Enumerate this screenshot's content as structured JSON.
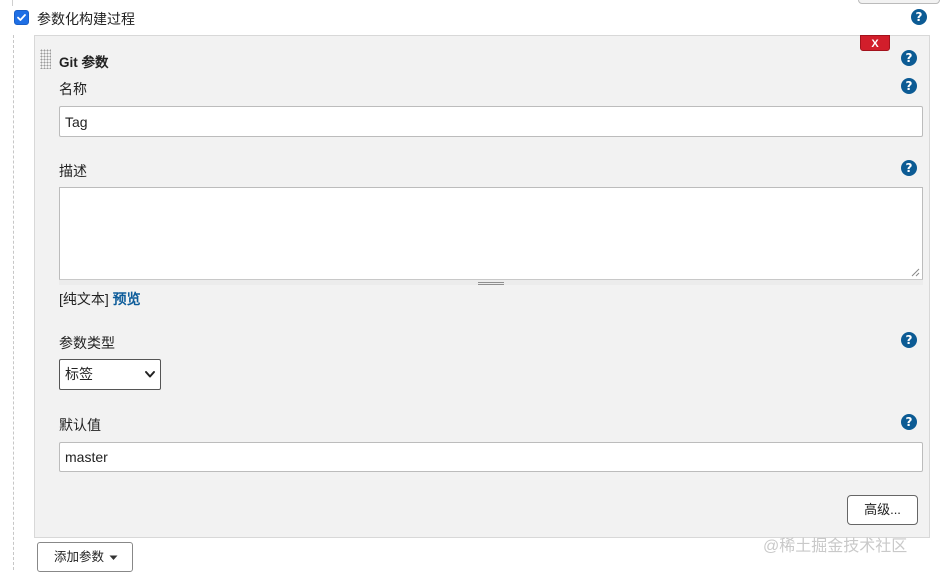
{
  "header": {
    "checkbox_checked": true,
    "title": "参数化构建过程"
  },
  "parameter": {
    "type_title": "Git 参数",
    "delete_label": "X",
    "name": {
      "label": "名称",
      "value": "Tag"
    },
    "description": {
      "label": "描述",
      "value": "",
      "format_text": "[纯文本]",
      "preview_link": "预览"
    },
    "param_type": {
      "label": "参数类型",
      "selected": "标签"
    },
    "default_value": {
      "label": "默认值",
      "value": "master"
    },
    "advanced_button": "高级..."
  },
  "add_parameter_button": "添加参数",
  "watermark": "@稀土掘金技术社区",
  "help_glyph": "?",
  "colors": {
    "help": "#0c5b94",
    "delete": "#d21e2b",
    "link": "#0d5c9a",
    "checkbox": "#1f6fe5"
  }
}
